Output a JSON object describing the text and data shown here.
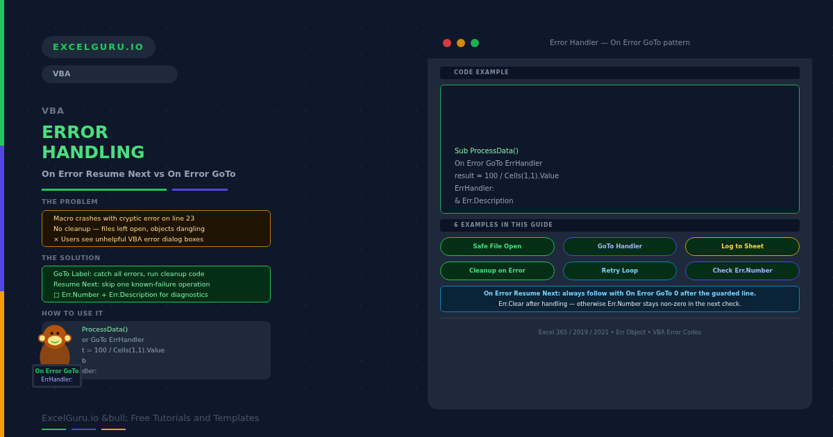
{
  "brand": "EXCELGURU.IO",
  "category": "VBA",
  "eyebrow": "VBA",
  "title": [
    "ERROR",
    "HANDLING"
  ],
  "subtitle": "On Error Resume Next vs On Error GoTo",
  "problem": {
    "heading": "THE PROBLEM",
    "lines": [
      "Macro crashes with cryptic error on line 23",
      "No cleanup — files left open, objects dangling",
      "× Users see unhelpful VBA error dialog boxes"
    ]
  },
  "solution": {
    "heading": "THE SOLUTION",
    "lines": [
      "GoTo Label: catch all errors, run cleanup code",
      "Resume Next: skip one known-failure operation",
      "□ Err.Number + Err.Description for diagnostics"
    ]
  },
  "how_to": {
    "heading": "HOW TO USE IT",
    "lines": [
      {
        "text": "ProcessData()",
        "kind": "keyword"
      },
      {
        "text": "or GoTo ErrHandler",
        "kind": "plain"
      },
      {
        "text": "t = 100 / Cells(1,1).Value",
        "kind": "plain"
      },
      {
        "text": "b",
        "kind": "plain"
      },
      {
        "text": "dler:",
        "kind": "plain"
      }
    ],
    "laptop_lines": [
      "On Error GoTo",
      "ErrHandler:"
    ]
  },
  "footer": "ExcelGuru.io &bull; Free Tutorials and Templates",
  "window": {
    "title": "Error Handler — On Error GoTo pattern",
    "controls": [
      {
        "color": "#d63c3c"
      },
      {
        "color": "#d4880f"
      },
      {
        "color": "#1fae4f"
      }
    ],
    "code_heading": "CODE EXAMPLE",
    "code": [
      {
        "text": "Sub ProcessData()",
        "kind": "keyword"
      },
      {
        "text": "On Error GoTo ErrHandler",
        "kind": "plain"
      },
      {
        "text": "result = 100 / Cells(1,1).Value",
        "kind": "plain"
      },
      {
        "text": "ErrHandler:",
        "kind": "plain"
      },
      {
        "text": "& Err.Description",
        "kind": "plain"
      }
    ],
    "examples_heading": "6 EXAMPLES IN THIS GUIDE",
    "examples": [
      {
        "label": "Safe File Open",
        "color": "#22c55e"
      },
      {
        "label": "GoTo Handler",
        "color": "#4f46e5"
      },
      {
        "label": "Log to Sheet",
        "color": "#e0a00e"
      },
      {
        "label": "Cleanup on Error",
        "color": "#22c55e"
      },
      {
        "label": "Retry Loop",
        "color": "#0e84b8"
      },
      {
        "label": "Check Err.Number",
        "color": "#4f46e5"
      }
    ],
    "note": {
      "bold": "On Error Resume Next: always follow with On Error GoTo 0 after the guarded line.",
      "text": "Err.Clear after handling — otherwise Err.Number stays non-zero in the next check."
    },
    "footer": "Excel 365 / 2019 / 2021 • Err Object • VBA Error Codes"
  }
}
